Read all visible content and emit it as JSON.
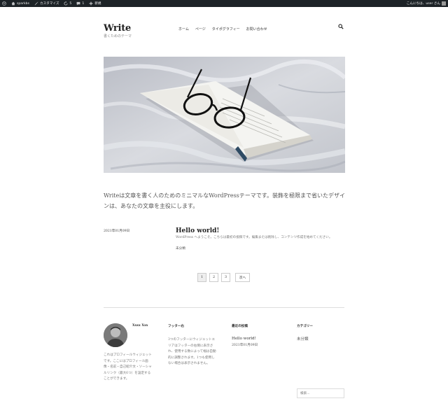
{
  "adminbar": {
    "items": [
      {
        "label": "sparkbs",
        "icon": "home-icon"
      },
      {
        "label": "カスタマイズ",
        "icon": "brush-icon"
      },
      {
        "label": "5",
        "icon": "updates-icon"
      },
      {
        "label": "1",
        "icon": "comment-icon"
      },
      {
        "label": "新規",
        "icon": "plus-icon"
      }
    ],
    "greeting": "こんにちは、user さん"
  },
  "header": {
    "site_title": "Write",
    "tagline": "書くためのテーマ",
    "nav": [
      "ホーム",
      "ページ",
      "タイポグラフィー",
      "お問い合わせ"
    ]
  },
  "intro": "Writeは文章を書く人のためのミニマルなWordPressテーマです。装飾を極限まで省いたデザインは、あなたの文章を主役にします。",
  "post": {
    "date": "2021年01月09日",
    "title": "Hello world!",
    "excerpt": "WordPress へようこそ。こちらは最初の投稿です。編集または削除し、コンテンツ作成を始めてください。",
    "category": "未分類"
  },
  "pagination": {
    "pages": [
      "1",
      "2",
      "3"
    ],
    "current": "1",
    "next": "次へ"
  },
  "footer": {
    "profile_name": "Xxxx Xxx",
    "profile_text": "これはプロフィールウィジェットです。ここにはプロフィール画像・名前・自己紹介文・ソーシャルリンク（最大6つ）を設定することができます。",
    "footer_heading": "フッター右",
    "footer_text": "3つのフッターにウィジェットエリアはフッターの右側に表示され、使用する数によって幅は自動的に調整されます。1つも使用しない場合は表示されません。",
    "recent_heading": "最近の投稿",
    "recent_link": "Hello world!",
    "recent_date": "2021年01月09日",
    "category_heading": "カテゴリー",
    "category_item": "未分類",
    "search_placeholder": "検索..."
  }
}
